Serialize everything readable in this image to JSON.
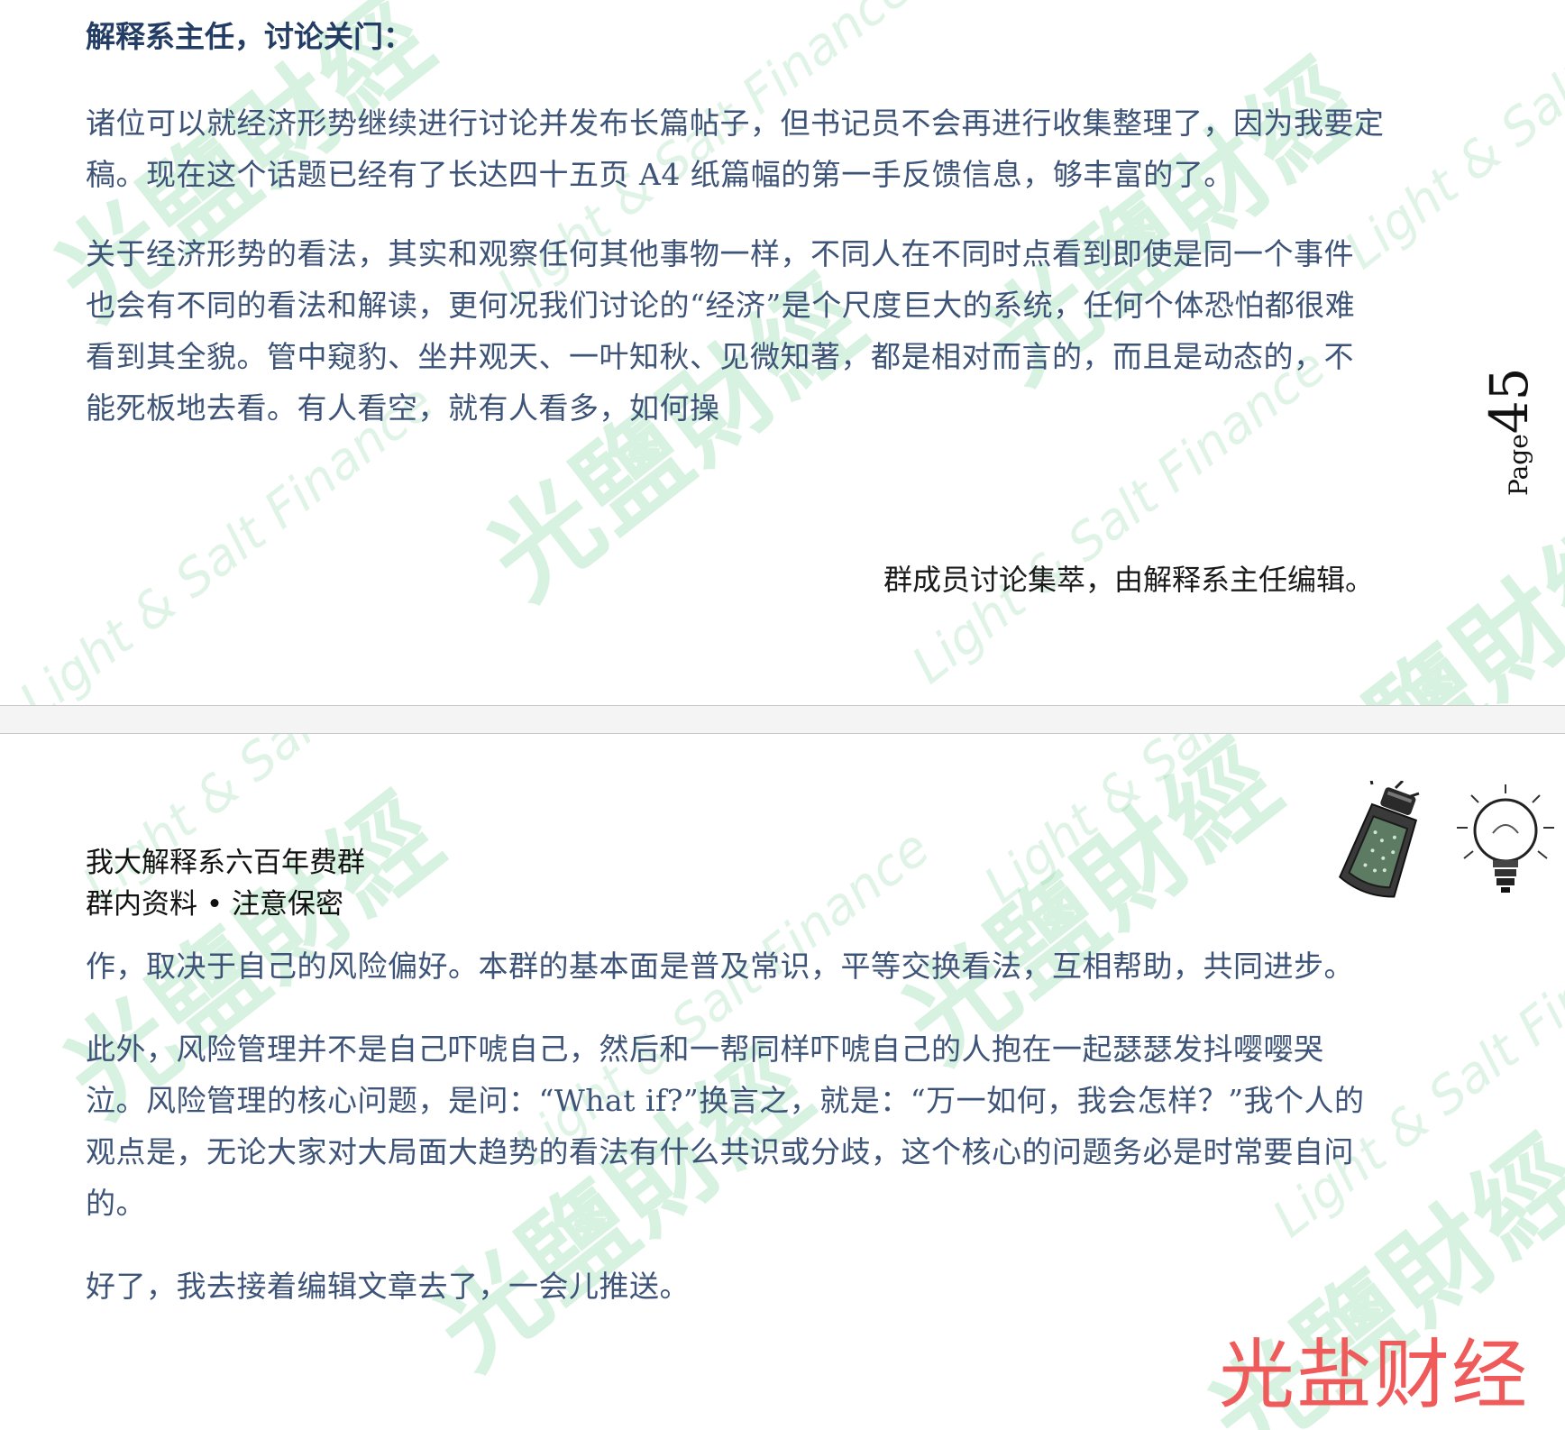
{
  "top_page": {
    "heading": "解释系主任，讨论关门：",
    "paragraphs": [
      "诸位可以就经济形势继续进行讨论并发布长篇帖子，但书记员不会再进行收集整理了，因为我要定稿。现在这个话题已经有了长达四十五页 A4 纸篇幅的第一手反馈信息，够丰富的了。",
      "关于经济形势的看法，其实和观察任何其他事物一样，不同人在不同时点看到即使是同一个事件也会有不同的看法和解读，更何况我们讨论的“经济”是个尺度巨大的系统，任何个体恐怕都很难看到其全貌。管中窥豹、坐井观天、一叶知秋、见微知著，都是相对而言的，而且是动态的，不能死板地去看。有人看空，就有人看多，如何操"
    ],
    "signature": "群成员讨论集萃，由解释系主任编辑。",
    "page_label": "Page",
    "page_number": "45"
  },
  "bottom_page": {
    "header_line1": "我大解释系六百年费群",
    "header_line2": "群内资料 • 注意保密",
    "icons": [
      "salt-shaker-icon",
      "lightbulb-icon"
    ],
    "paragraphs": [
      "作，取决于自己的风险偏好。本群的基本面是普及常识，平等交换看法，互相帮助，共同进步。",
      "此外，风险管理并不是自己吓唬自己，然后和一帮同样吓唬自己的人抱在一起瑟瑟发抖嘤嘤哭泣。风险管理的核心问题，是问：“What if?”换言之，就是：“万一如何，我会怎样？”我个人的观点是，无论大家对大局面大趋势的看法有什么共识或分歧，这个核心的问题务必是时常要自问的。",
      "好了，我去接着编辑文章去了，一会儿推送。"
    ]
  },
  "watermark": {
    "text_cn": "光鹽財經",
    "text_en": "Light & Salt Finance"
  },
  "brand_mark": "光盐财经",
  "colors": {
    "body_text": "#3d5478",
    "heading": "#233d64",
    "watermark": "#82d69e",
    "brand_mark": "#ef5a5a"
  }
}
